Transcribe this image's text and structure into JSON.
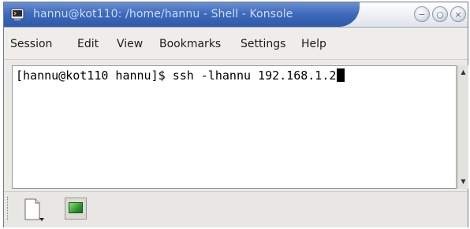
{
  "window": {
    "title": "hannu@kot110: /home/hannu - Shell - Konsole",
    "minimize_glyph": "−",
    "maximize_glyph": "○",
    "close_glyph": "×"
  },
  "menubar": {
    "items": [
      "Session",
      "Edit",
      "View",
      "Bookmarks",
      "Settings",
      "Help"
    ]
  },
  "terminal": {
    "prompt": "[hannu@kot110 hannu]$ ",
    "command": "ssh -lhannu 192.168.1.2"
  },
  "scrollbar": {
    "up_glyph": "▲",
    "down_glyph": "▼"
  },
  "icons": {
    "app": "konsole-icon",
    "new_session": "new-session-icon",
    "session": "terminal-session-icon"
  },
  "colors": {
    "title_active": "#3e6bbd",
    "title_text": "#cfdcf3",
    "terminal_bg": "#ffffff",
    "terminal_fg": "#000000"
  }
}
